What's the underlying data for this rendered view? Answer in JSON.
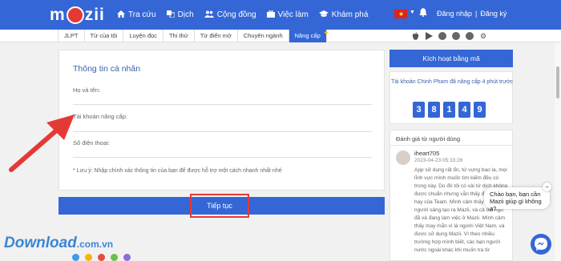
{
  "app": {
    "logo_text_left": "m",
    "logo_text_right": "zii"
  },
  "nav": {
    "items": [
      {
        "label": "Tra cứu",
        "icon": "home-icon"
      },
      {
        "label": "Dịch",
        "icon": "translate-icon"
      },
      {
        "label": "Cộng đồng",
        "icon": "community-icon"
      },
      {
        "label": "Việc làm",
        "icon": "briefcase-icon"
      },
      {
        "label": "Khám phá",
        "icon": "graduation-cap-icon"
      }
    ],
    "login": "Đăng nhập",
    "signup": "Đăng ký"
  },
  "tabs": [
    "JLPT",
    "Từ của tôi",
    "Luyện đọc",
    "Thi thử",
    "Từ điển mở",
    "Chuyên ngành",
    "Nâng cấp"
  ],
  "active_tab": "Nâng cấp",
  "form": {
    "title": "Thông tin cá nhân",
    "name_label": "Họ và tên:",
    "account_label": "Tài khoản nâng cấp:",
    "phone_label": "Số điện thoại:",
    "note": "* Lưu ý: Nhập chính xác thông tin của bạn để được hỗ trợ một cách nhanh nhất nhé",
    "continue": "Tiếp tục"
  },
  "sidebar": {
    "activate": "Kích hoạt bằng mã",
    "recent_text": "Tài khoản Chinh Pham đã nâng cấp 4 phút trước",
    "counter_digits": [
      "3",
      "8",
      "1",
      "4",
      "9"
    ],
    "reviews_title": "Đánh giá từ người dùng",
    "review": {
      "user": "iheart705",
      "date": "2023-04-23 05:33:26",
      "body": "App sử dụng rất ổn, từ vựng bao la, mọi lĩnh vực mình muốn tìm kiếm đều có trong này. Do đó tôi có vài từ dịch không được chuẩn nhưng vẫn thấy được rất hay của Team. Mình cảm thấy rất tiện ơn người sáng tạo ra Mazii, và cả đội ngũ đã và đang làm việc ở Mazii. Mình cảm thấy may mắn vì là người Việt Nam, và được sử dụng Mazii. Vì theo nhiều trường hợp mình biết, các bạn người nước ngoài khác khi muốn tra từ"
    }
  },
  "chat": {
    "bubble": "Chào bạn, bạn cần Mazii giúp gì không ạ?",
    "close": "−"
  },
  "watermark": {
    "brand": "Download",
    "suffix": ".com.vn",
    "dot_colors": [
      "#3d9be9",
      "#f7b500",
      "#e84c3d",
      "#6cc04a",
      "#8e6bd8"
    ]
  },
  "colors": {
    "primary": "#3466d6",
    "accent_red": "#e53935"
  }
}
